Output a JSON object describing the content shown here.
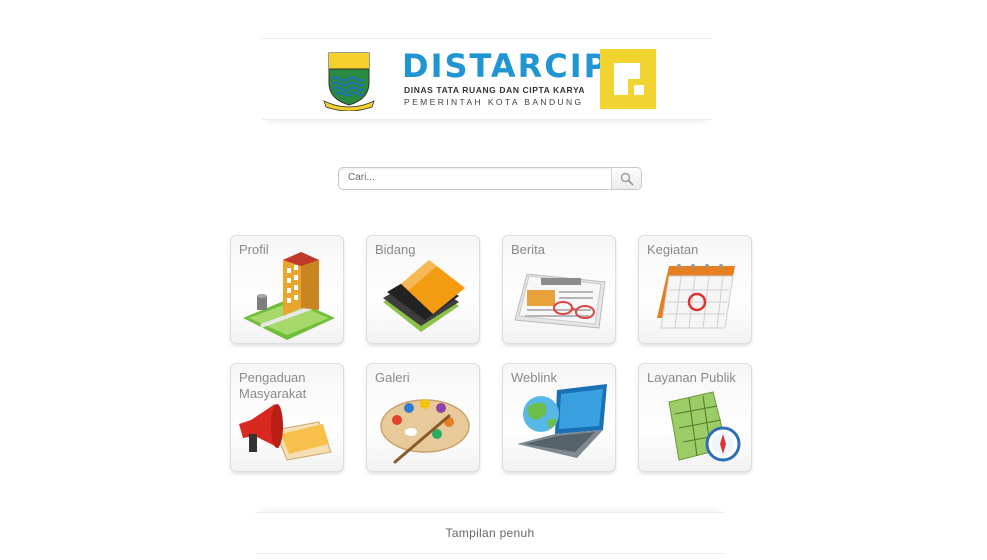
{
  "header": {
    "title": "DISTARCIP",
    "subtitle": "DINAS TATA RUANG DAN CIPTA KARYA",
    "subtitle2": "PEMERINTAH KOTA BANDUNG",
    "colors": {
      "title": "#1f95d3",
      "pu_logo": "#f2d430"
    }
  },
  "search": {
    "placeholder": "Cari...",
    "value": "",
    "icon": "magnifier-icon"
  },
  "tiles": [
    {
      "label": "Profil",
      "icon": "building-icon"
    },
    {
      "label": "Bidang",
      "icon": "folders-icon"
    },
    {
      "label": "Berita",
      "icon": "newspaper-glasses-icon"
    },
    {
      "label": "Kegiatan",
      "icon": "calendar-icon"
    },
    {
      "label": "Pengaduan Masyarakat",
      "icon": "megaphone-icon"
    },
    {
      "label": "Galeri",
      "icon": "palette-icon"
    },
    {
      "label": "Weblink",
      "icon": "laptop-globe-icon"
    },
    {
      "label": "Layanan Publik",
      "icon": "map-compass-icon"
    }
  ],
  "footer": {
    "link_label": "Tampilan penuh"
  }
}
